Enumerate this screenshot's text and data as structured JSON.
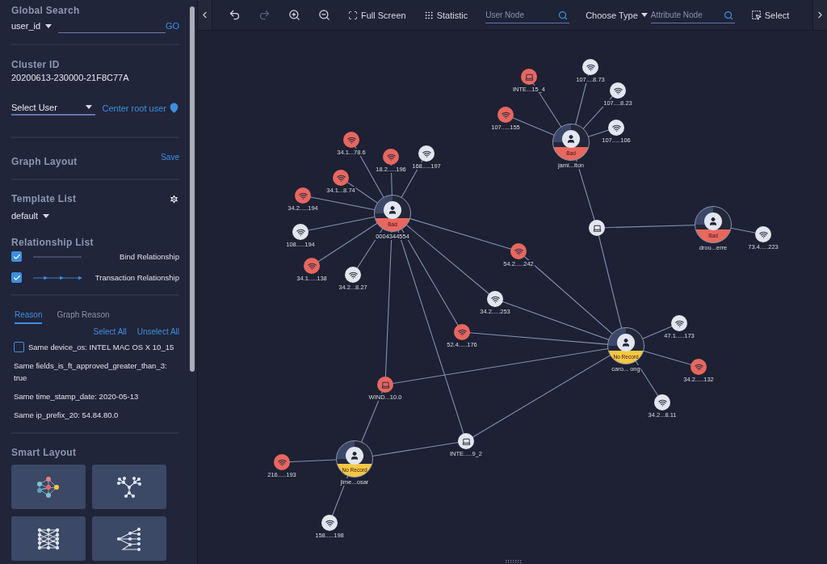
{
  "sidebar": {
    "global_search": {
      "title": "Global Search",
      "field_select": "user_id",
      "go": "GO"
    },
    "cluster": {
      "title": "Cluster ID",
      "value": "20200613-230000-21F8C77A"
    },
    "select_user": {
      "value": "Select User",
      "center_link": "Center root user"
    },
    "graph_layout": {
      "title": "Graph Layout",
      "save": "Save"
    },
    "template_list": {
      "title": "Template List",
      "value": "default"
    },
    "relationship_list": {
      "title": "Relationship List",
      "items": [
        {
          "kind": "line",
          "label": "Bind Relationship",
          "checked": true
        },
        {
          "kind": "arrow",
          "label": "Transaction Relationship",
          "checked": true
        }
      ]
    },
    "reason_tabs": [
      {
        "label": "Reason",
        "selected": true
      },
      {
        "label": "Graph Reason",
        "selected": false
      }
    ],
    "select_all": "Select All",
    "unselect_all": "Unselect All",
    "reasons": [
      {
        "kind": "checkbox",
        "text": "Same device_os: INTEL MAC OS X 10_15",
        "checked": false
      },
      {
        "kind": "text",
        "text": "Same fields_is_ft_approved_greater_than_3: true"
      },
      {
        "kind": "text",
        "text": "Same time_stamp_date: 2020-05-13"
      },
      {
        "kind": "text",
        "text": "Same ip_prefix_20: 54.84.80.0"
      }
    ],
    "smart_layout": {
      "title": "Smart Layout",
      "tiles": [
        {
          "kind": "force"
        },
        {
          "kind": "tree"
        },
        {
          "kind": "grid"
        },
        {
          "kind": "dagre"
        }
      ]
    }
  },
  "toolbar": [
    {
      "kind": "undo",
      "disabled": false
    },
    {
      "kind": "redo",
      "disabled": true
    },
    {
      "kind": "zoom-in",
      "disabled": false
    },
    {
      "kind": "zoom-out",
      "disabled": false
    },
    {
      "kind": "fullscreen",
      "label": "Full Screen",
      "disabled": false
    },
    {
      "kind": "statistic",
      "label": "Statistic",
      "disabled": false
    },
    {
      "kind": "search",
      "placeholder": "User Node"
    },
    {
      "kind": "dropdown",
      "label": "Choose Type",
      "disabled": false
    },
    {
      "kind": "search",
      "placeholder": "Attribute Node"
    },
    {
      "kind": "select",
      "label": "Select",
      "disabled": false
    }
  ],
  "graph": {
    "nodes": [
      {
        "kind": "user",
        "label": "0004344554",
        "badge": "Bad",
        "color": "#e8675f"
      },
      {
        "kind": "user",
        "label": "jami...lton",
        "badge": "Bad",
        "color": "#e8675f"
      },
      {
        "kind": "user",
        "label": "drou...erre",
        "badge": "Bad",
        "color": "#e8675f"
      },
      {
        "kind": "user",
        "label": "caro... ong",
        "badge": "No Record",
        "color": "#f5c842"
      },
      {
        "kind": "user",
        "label": "jime...osar",
        "badge": "No Record",
        "color": "#f5c842"
      },
      {
        "kind": "device",
        "label": "INTE...15_4",
        "color": "#e8675f"
      },
      {
        "kind": "ip",
        "label": "107....8.73",
        "color": "#e3e6ef"
      },
      {
        "kind": "ip",
        "label": "107....8.23",
        "color": "#e3e6ef"
      },
      {
        "kind": "ip",
        "label": "107.....155",
        "color": "#e8675f"
      },
      {
        "kind": "ip",
        "label": "107.....106",
        "color": "#e3e6ef"
      },
      {
        "kind": "ip",
        "label": "34.1...78.6",
        "color": "#e8675f"
      },
      {
        "kind": "ip",
        "label": "18.2.....196",
        "color": "#e8675f"
      },
      {
        "kind": "ip",
        "label": "168.....197",
        "color": "#e3e6ef"
      },
      {
        "kind": "ip",
        "label": "34.1...8.74",
        "color": "#e8675f"
      },
      {
        "kind": "ip",
        "label": "34.2.....194",
        "color": "#e8675f"
      },
      {
        "kind": "ip",
        "label": "108.....194",
        "color": "#e3e6ef"
      },
      {
        "kind": "ip",
        "label": "34.1.....138",
        "color": "#e8675f"
      },
      {
        "kind": "ip",
        "label": "34.2...8.27",
        "color": "#e3e6ef"
      },
      {
        "kind": "ip",
        "label": "54.2.....242",
        "color": "#e8675f"
      },
      {
        "kind": "ip",
        "label": "34.2.....253",
        "color": "#e3e6ef"
      },
      {
        "kind": "ip",
        "label": "52.4.....176",
        "color": "#e8675f"
      },
      {
        "kind": "device",
        "label": "WIND...10.0",
        "color": "#e8675f"
      },
      {
        "kind": "device",
        "label": "INTE.....9_2",
        "color": "#e3e6ef"
      },
      {
        "kind": "device",
        "color": "#e3e6ef"
      },
      {
        "kind": "ip",
        "label": "73.4.....223",
        "color": "#e3e6ef"
      },
      {
        "kind": "ip",
        "label": "47.1.....173",
        "color": "#e3e6ef"
      },
      {
        "kind": "ip",
        "label": "34.2.....132",
        "color": "#e8675f"
      },
      {
        "kind": "ip",
        "label": "34.2...8.11",
        "color": "#e3e6ef"
      },
      {
        "kind": "ip",
        "label": "216.....193",
        "color": "#e8675f"
      },
      {
        "kind": "ip",
        "label": "158.....198",
        "color": "#e3e6ef"
      }
    ]
  }
}
